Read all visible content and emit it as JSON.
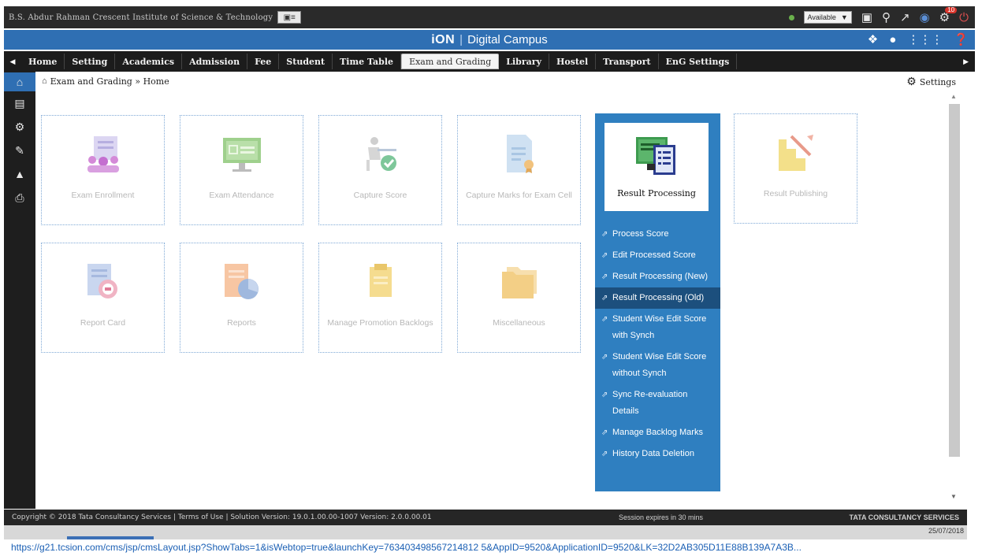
{
  "topbar": {
    "institution": "B.S. Abdur Rahman Crescent Institute of Science & Technology",
    "status": "Available",
    "notification_count": "10",
    "icons": [
      "id-card-icon",
      "status-dot-icon",
      "camera-icon",
      "search-icon",
      "link-icon",
      "globe-icon",
      "bell-icon",
      "power-icon"
    ]
  },
  "titlebar": {
    "brand": "iON",
    "product": "Digital Campus",
    "icons": [
      "chat-icon",
      "download-icon",
      "apps-grid-icon",
      "help-icon"
    ]
  },
  "nav": {
    "tabs": [
      {
        "label": "Home"
      },
      {
        "label": "Setting"
      },
      {
        "label": "Academics"
      },
      {
        "label": "Admission"
      },
      {
        "label": "Fee"
      },
      {
        "label": "Student"
      },
      {
        "label": "Time Table"
      },
      {
        "label": "Exam and Grading",
        "active": true
      },
      {
        "label": "Library"
      },
      {
        "label": "Hostel"
      },
      {
        "label": "Transport"
      },
      {
        "label": "EnG Settings"
      }
    ]
  },
  "sidebar": {
    "items": [
      "home-icon",
      "form-icon",
      "settings-icon",
      "edit-icon",
      "people-icon",
      "printer-icon"
    ]
  },
  "breadcrumb": {
    "text": "Exam and Grading » Home",
    "settings_label": "Settings"
  },
  "tiles": [
    {
      "label": "Exam Enrollment",
      "icon": "enrollment-icon"
    },
    {
      "label": "Exam Attendance",
      "icon": "attendance-icon"
    },
    {
      "label": "Capture Score",
      "icon": "capture-score-icon"
    },
    {
      "label": "Capture Marks for Exam Cell",
      "icon": "capture-marks-icon"
    },
    {
      "label": "Result Publishing",
      "icon": "publishing-icon"
    },
    {
      "label": "Report Card",
      "icon": "report-card-icon"
    },
    {
      "label": "Reports",
      "icon": "reports-icon"
    },
    {
      "label": "Manage Promotion Backlogs",
      "icon": "backlogs-icon"
    },
    {
      "label": "Miscellaneous",
      "icon": "folder-icon"
    }
  ],
  "result_processing": {
    "label": "Result Processing",
    "menu": [
      {
        "label": "Process Score"
      },
      {
        "label": "Edit Processed Score"
      },
      {
        "label": "Result Processing (New)"
      },
      {
        "label": "Result Processing (Old)",
        "highlighted": true
      },
      {
        "label": "Student Wise Edit Score with Synch"
      },
      {
        "label": "Student Wise Edit Score without Synch"
      },
      {
        "label": "Sync Re-evaluation Details"
      },
      {
        "label": "Manage Backlog Marks"
      },
      {
        "label": "History Data Deletion"
      }
    ]
  },
  "footer": {
    "copyright": "Copyright © 2018 Tata Consultancy Services | Terms of Use | Solution Version: 19.0.1.00.00-1007 Version: 2.0.0.00.01",
    "session": "Session expires in 30 mins",
    "brand": "TATA CONSULTANCY SERVICES"
  },
  "taskbar": {
    "clock": "25/07/2018"
  },
  "url": "https://g21.tcsion.com/cms/jsp/cmsLayout.jsp?ShowTabs=1&isWebtop=true&launchKey=763403498567214812 5&AppID=9520&ApplicationID=9520&LK=32D2AB305D11E88B139A7A3B...",
  "colors": {
    "primary_blue": "#2f6fb3",
    "panel_blue": "#2f7fc0",
    "dark_bar": "#1c1c1c"
  }
}
